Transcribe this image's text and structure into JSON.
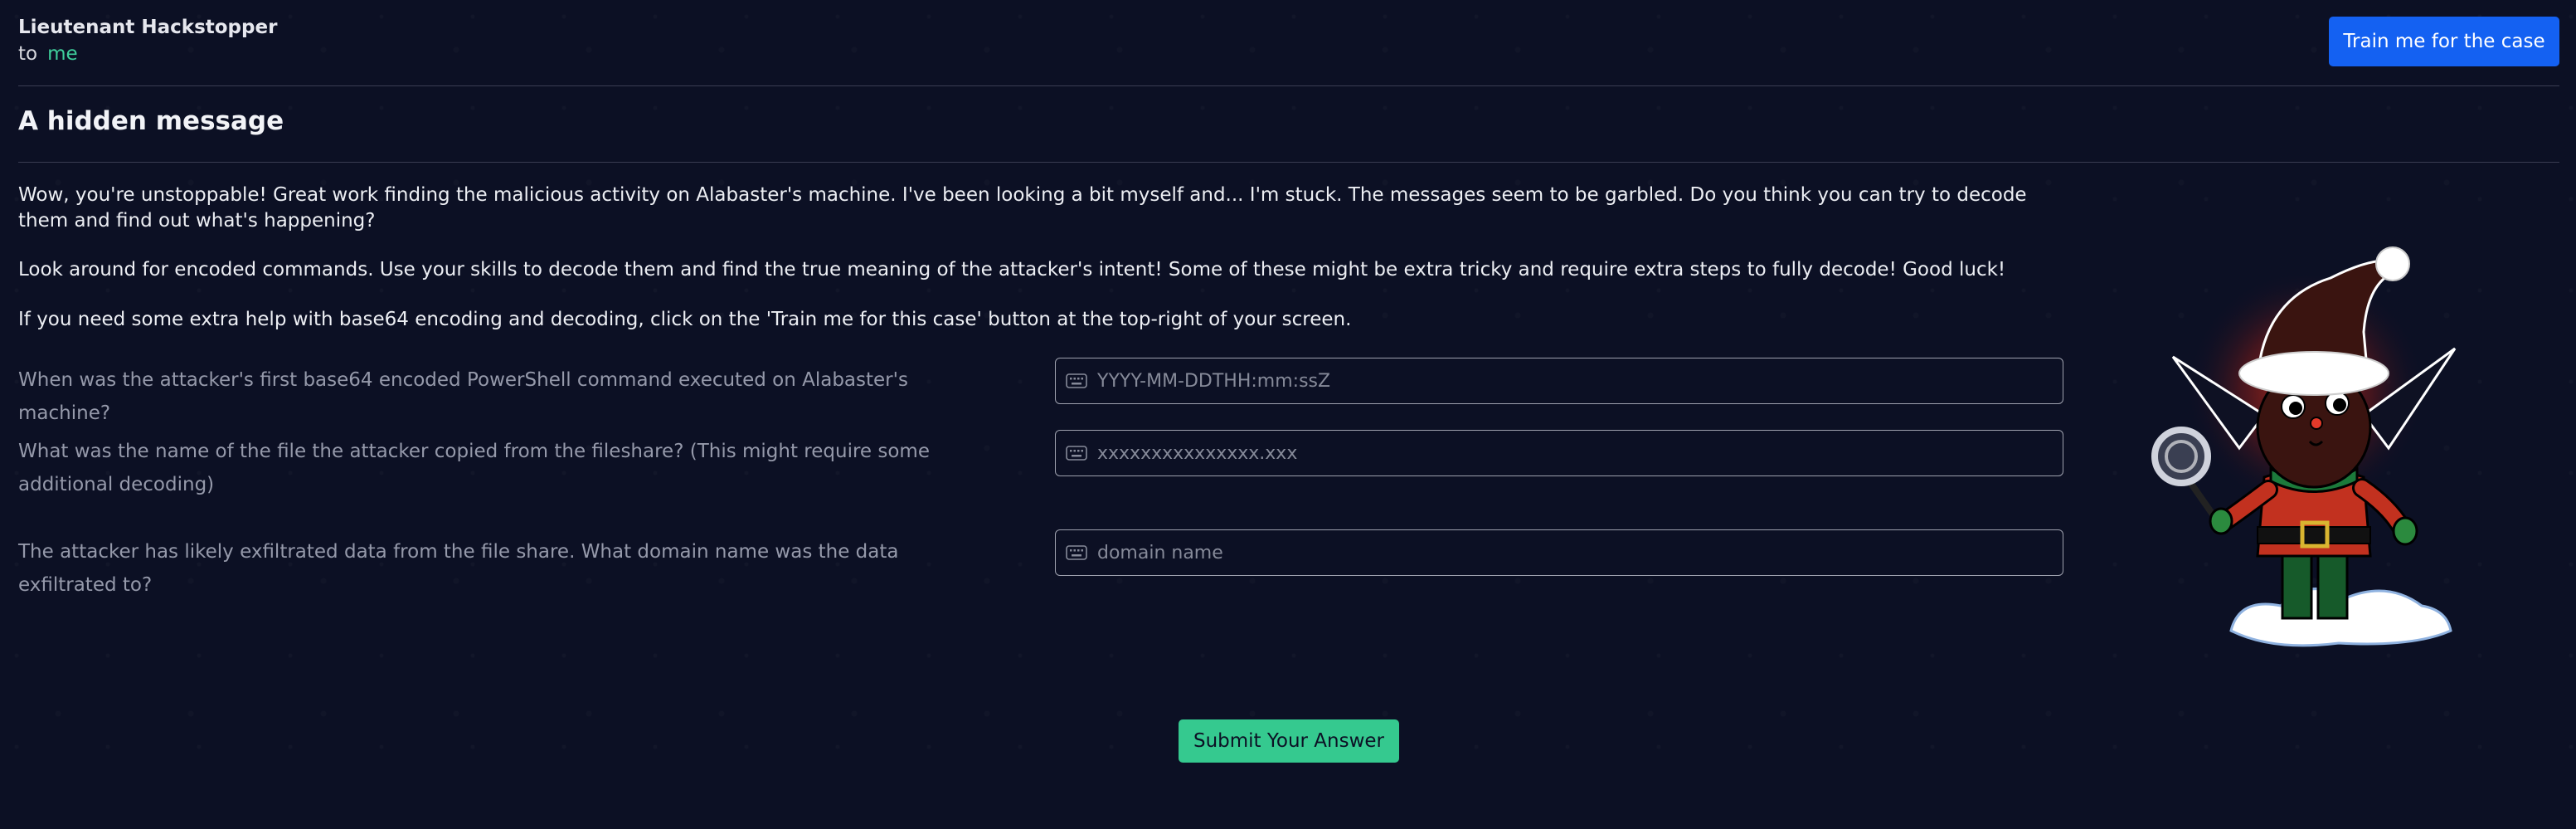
{
  "header": {
    "sender_name": "Lieutenant Hackstopper",
    "to_label": "to",
    "recipient": "me",
    "train_button_label": "Train me for the case"
  },
  "message": {
    "title": "A hidden message",
    "paragraphs": [
      "Wow, you're unstoppable! Great work finding the malicious activity on Alabaster's machine. I've been looking a bit myself and... I'm stuck. The messages seem to be garbled. Do you think you can try to decode them and find out what's happening?",
      "Look around for encoded commands. Use your skills to decode them and find the true meaning of the attacker's intent! Some of these might be extra tricky and require extra steps to fully decode! Good luck!",
      "If you need some extra help with base64 encoding and decoding, click on the 'Train me for this case' button at the top-right of your screen."
    ]
  },
  "questions": [
    {
      "label": "When was the attacker's first base64 encoded PowerShell command executed on Alabaster's machine?",
      "placeholder": "YYYY-MM-DDTHH:mm:ssZ",
      "value": ""
    },
    {
      "label": "What was the name of the file the attacker copied from the fileshare? (This might require some additional decoding)",
      "placeholder": "xxxxxxxxxxxxxxx.xxx",
      "value": ""
    },
    {
      "label": "The attacker has likely exfiltrated data from the file share. What domain name was the data exfiltrated to?",
      "placeholder": "domain name",
      "value": ""
    }
  ],
  "submit_label": "Submit Your Answer",
  "icons": {
    "field_icon": "keyboard-icon",
    "illustration": "elf-detective-illustration"
  },
  "colors": {
    "background": "#0c1024",
    "primary_button": "#1461f2",
    "submit_button": "#35c98f",
    "recipient": "#3fcf9c"
  }
}
